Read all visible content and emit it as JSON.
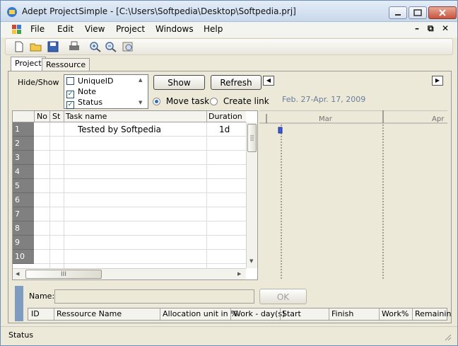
{
  "window": {
    "title": "Adept ProjectSimple - [C:\\Users\\Softpedia\\Desktop\\Softpedia.prj]"
  },
  "menu": {
    "items": [
      "File",
      "Edit",
      "View",
      "Project",
      "Windows",
      "Help"
    ]
  },
  "toolbar": {
    "icons": [
      "new-icon",
      "open-icon",
      "save-icon",
      "print-icon",
      "zoom-in-icon",
      "zoom-out-icon",
      "fit-icon"
    ]
  },
  "tabs": [
    "Project",
    "Ressource"
  ],
  "filter": {
    "label": "Hide/Show",
    "options": [
      {
        "label": "UniqueID",
        "checked": false
      },
      {
        "label": "Note",
        "checked": true
      },
      {
        "label": "Status",
        "checked": true
      }
    ],
    "show_label": "Show",
    "refresh_label": "Refresh"
  },
  "mode": {
    "move_label": "Move task",
    "link_label": "Create link",
    "selected": "move"
  },
  "gantt": {
    "range_label": "Feb. 27-Apr. 17, 2009",
    "months": [
      "Mar",
      "Apr"
    ]
  },
  "grid": {
    "columns": [
      "No",
      "St",
      "Task name",
      "Duration"
    ],
    "rows": [
      {
        "num": "1",
        "task": "Tested by Softpedia",
        "duration": "1d"
      },
      {
        "num": "2",
        "task": "",
        "duration": ""
      },
      {
        "num": "3",
        "task": "",
        "duration": ""
      },
      {
        "num": "4",
        "task": "",
        "duration": ""
      },
      {
        "num": "5",
        "task": "",
        "duration": ""
      },
      {
        "num": "6",
        "task": "",
        "duration": ""
      },
      {
        "num": "7",
        "task": "",
        "duration": ""
      },
      {
        "num": "8",
        "task": "",
        "duration": ""
      },
      {
        "num": "9",
        "task": "",
        "duration": ""
      },
      {
        "num": "10",
        "task": "",
        "duration": ""
      }
    ],
    "hscroll_grip": "III"
  },
  "resource": {
    "name_label": "Name:",
    "name_value": "",
    "ok_label": "OK",
    "columns": [
      "ID",
      "Ressource Name",
      "Allocation unit in %",
      "Work - day(s)",
      "Start",
      "Finish",
      "Work%",
      "Remainin"
    ]
  },
  "status": {
    "text": "Status"
  },
  "colors": {
    "task_bar": "#3b5bd8",
    "rownum_bg": "#808080"
  }
}
